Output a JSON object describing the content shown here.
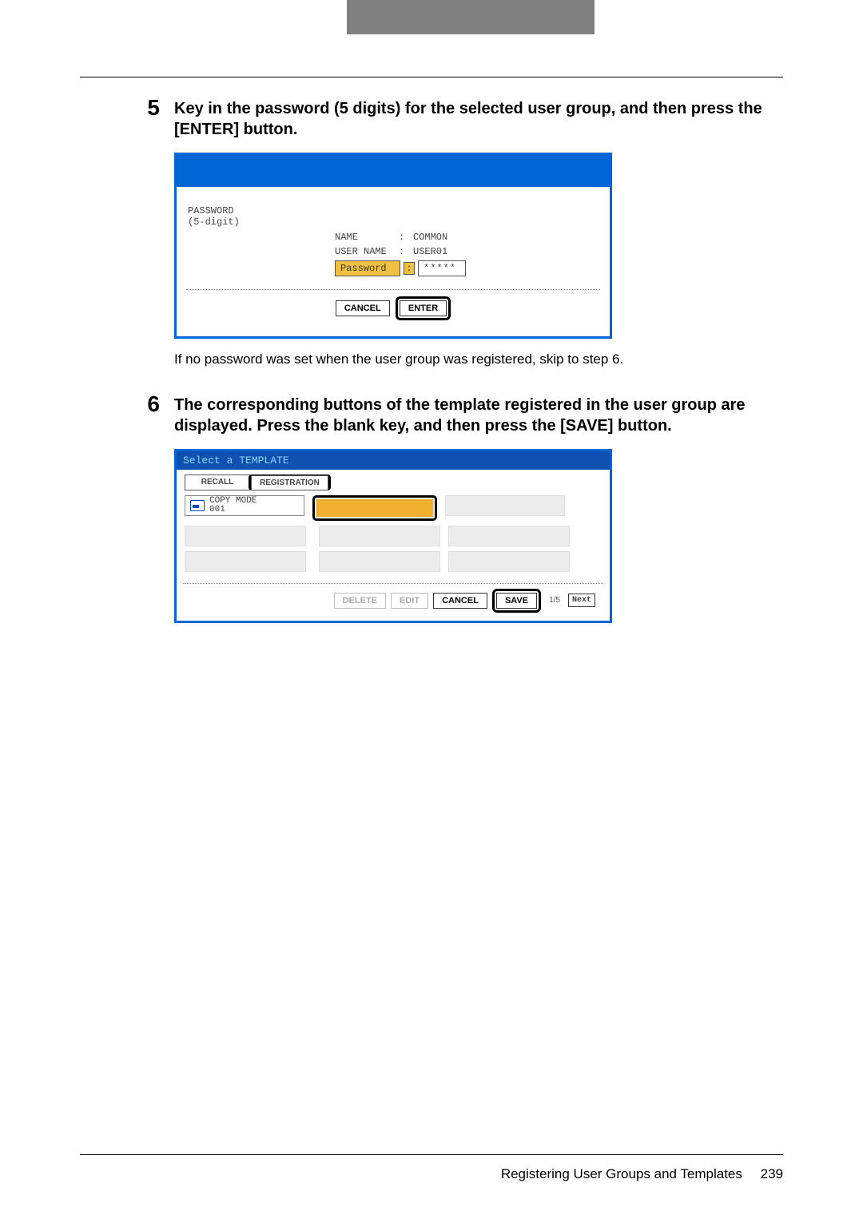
{
  "step5": {
    "num": "5",
    "text": "Key in the password (5 digits) for the selected user group, and then press the [ENTER] button.",
    "note": "If no password was set when the user group was registered, skip to step 6.",
    "panel": {
      "pwd_label_l1": "PASSWORD",
      "pwd_label_l2": "(5-digit)",
      "name_k": "NAME",
      "colon": ":",
      "name_v": "COMMON",
      "user_k": "USER NAME",
      "user_v": "USER01",
      "pwd_k": "Password",
      "pwd_v": "*****",
      "cancel_btn": "CANCEL",
      "enter_btn": "ENTER"
    }
  },
  "step6": {
    "num": "6",
    "text": "The corresponding buttons of the template registered in the user group are displayed. Press the blank key, and then press the [SAVE] button.",
    "panel": {
      "title": "Select a TEMPLATE",
      "tab_recall": "RECALL",
      "tab_reg": "REGISTRATION",
      "cell0_l1": "COPY MODE",
      "cell0_l2": "001",
      "delete_btn": "DELETE",
      "edit_btn": "EDIT",
      "cancel_btn": "CANCEL",
      "save_btn": "SAVE",
      "page": "1/5",
      "next_btn": "Next"
    }
  },
  "footer": {
    "text": "Registering User Groups and Templates",
    "page": "239"
  }
}
